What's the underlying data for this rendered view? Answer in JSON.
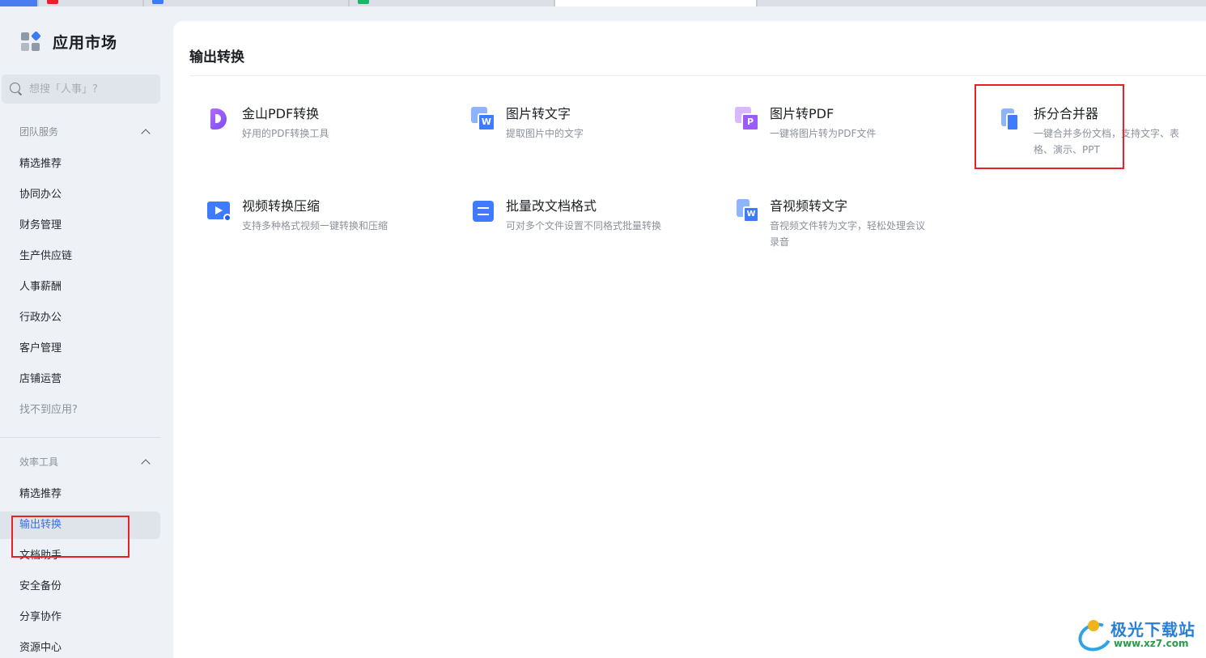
{
  "sidebar": {
    "brand_title": "应用市场",
    "search_placeholder": "想搜「人事」?",
    "group_team": {
      "title": "团队服务",
      "items": [
        "精选推荐",
        "协同办公",
        "财务管理",
        "生产供应链",
        "人事薪酬",
        "行政办公",
        "客户管理",
        "店铺运营"
      ],
      "footer": "找不到应用?"
    },
    "group_efficiency": {
      "title": "效率工具",
      "items": [
        "精选推荐",
        "输出转换",
        "文档助手",
        "安全备份",
        "分享协作",
        "资源中心"
      ],
      "active_item": "输出转换"
    }
  },
  "main": {
    "section_title": "输出转换",
    "apps": [
      {
        "name": "金山PDF转换",
        "desc": "好用的PDF转换工具",
        "icon": "pdf-convert-icon"
      },
      {
        "name": "图片转文字",
        "desc": "提取图片中的文字",
        "icon": "image-to-text-icon"
      },
      {
        "name": "图片转PDF",
        "desc": "一键将图片转为PDF文件",
        "icon": "image-to-pdf-icon"
      },
      {
        "name": "拆分合并器",
        "desc": "一键合并多份文档，支持文字、表格、演示、PPT",
        "icon": "split-merge-icon"
      },
      {
        "name": "视频转换压缩",
        "desc": "支持多种格式视频一键转换和压缩",
        "icon": "video-convert-icon"
      },
      {
        "name": "批量改文档格式",
        "desc": "可对多个文件设置不同格式批量转换",
        "icon": "batch-format-icon"
      },
      {
        "name": "音视频转文字",
        "desc": "音视频文件转为文字，轻松处理会议录音",
        "icon": "audio-video-to-text-icon"
      }
    ]
  },
  "watermark": {
    "text": "极光下载站",
    "url": "www.xz7.com"
  },
  "colors": {
    "accent": "#3a6ff0",
    "highlight": "#e8202a"
  }
}
